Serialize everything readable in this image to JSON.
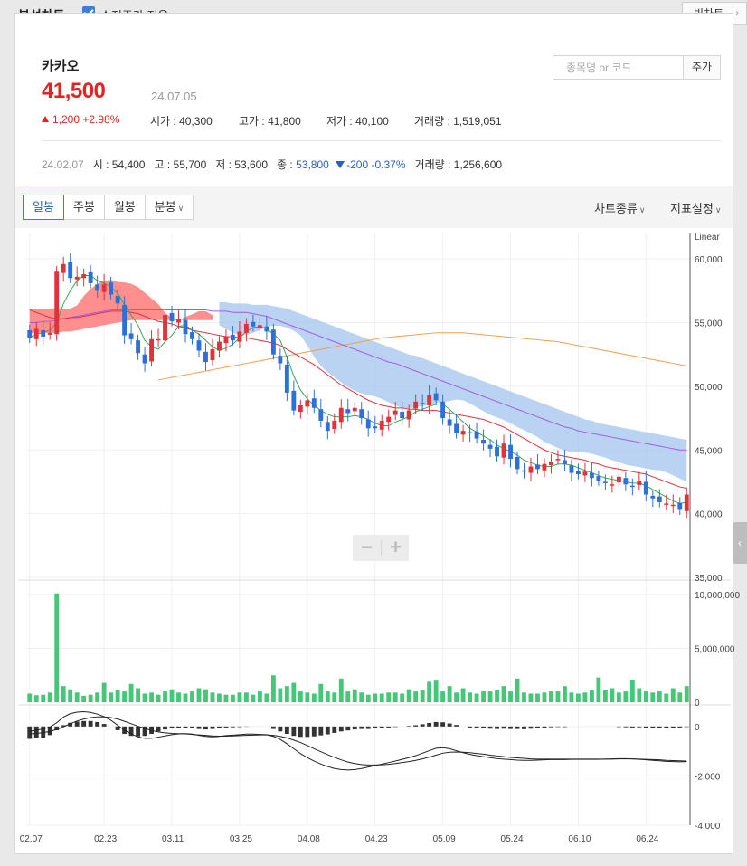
{
  "header": {
    "title": "분석차트",
    "adjusted_label": "수정주가 적용",
    "adjusted_checked": true,
    "big_chart_label": "빅차트"
  },
  "search": {
    "placeholder": "종목명 or 코드",
    "button": "추가"
  },
  "stock": {
    "name": "카카오",
    "price": "41,500",
    "date": "24.07.05",
    "change": "1,200 +2.98%",
    "open": "시가 : 40,300",
    "high": "고가 : 41,800",
    "low": "저가 : 40,100",
    "volume": "거래량 : 1,519,051"
  },
  "compare": {
    "date": "24.02.07",
    "open": "시 : 54,400",
    "high": "고 : 55,700",
    "low": "저 : 53,600",
    "close_label": "종 :",
    "close": "53,800",
    "change": "-200 -0.37%",
    "volume": "거래량 : 1,256,600"
  },
  "tabs": [
    {
      "label": "일봉"
    },
    {
      "label": "주봉"
    },
    {
      "label": "월봉"
    },
    {
      "label": "분봉"
    }
  ],
  "toolbar": {
    "chart_type": "차트종류",
    "indicator": "지표설정"
  },
  "zoom": {
    "minus": "−",
    "plus": "+"
  },
  "colors": {
    "up": "#e0323a",
    "down": "#2e6fd8",
    "volume": "#44c878",
    "cloud_bull": "#ff7b7b",
    "cloud_bear": "#9cc0ee",
    "ma5": "#3aa657",
    "ma20": "#e0323a",
    "ma60": "#a45de0",
    "ma120": "#f0a050"
  },
  "chart_data": {
    "type": "candlestick",
    "scale_label": "Linear",
    "price_axis": {
      "ticks": [
        "60,000",
        "55,000",
        "50,000",
        "45,000",
        "40,000",
        "35,000"
      ],
      "values": [
        60000,
        55000,
        50000,
        45000,
        40000,
        35000
      ],
      "ylim": [
        35000,
        62000
      ]
    },
    "volume_axis": {
      "ticks": [
        "10,000,000",
        "5,000,000",
        "0"
      ],
      "values": [
        10000000,
        5000000,
        0
      ],
      "ylim": [
        0,
        11000000
      ]
    },
    "macd_axis": {
      "ticks": [
        "0",
        "-2,000",
        "-4,000"
      ],
      "values": [
        0,
        -2000,
        -4000
      ],
      "ylim": [
        -4000,
        800
      ]
    },
    "x_ticks": [
      "02.07",
      "02.23",
      "03.11",
      "03.25",
      "04.08",
      "04.23",
      "05.09",
      "05.24",
      "06.10",
      "06.24"
    ],
    "x_tick_index": [
      0,
      11,
      21,
      31,
      41,
      51,
      61,
      71,
      81,
      91
    ],
    "closes": [
      53800,
      54500,
      53900,
      54200,
      59000,
      59600,
      58500,
      58600,
      58800,
      58100,
      57500,
      58000,
      57200,
      56500,
      54000,
      53700,
      52600,
      51800,
      53700,
      53700,
      55600,
      55100,
      55300,
      54100,
      53700,
      52800,
      51900,
      52900,
      53500,
      53900,
      53600,
      54300,
      54900,
      54700,
      54800,
      54300,
      52500,
      51800,
      49500,
      48100,
      48500,
      48900,
      48300,
      47300,
      46500,
      47300,
      48300,
      47900,
      48300,
      47500,
      46700,
      46700,
      47300,
      47600,
      48100,
      47500,
      48100,
      48800,
      48600,
      49300,
      48900,
      47500,
      46900,
      46300,
      46500,
      46300,
      45900,
      45500,
      45100,
      44500,
      45500,
      44300,
      43500,
      43300,
      43700,
      43500,
      43900,
      44100,
      44300,
      43900,
      43200,
      43100,
      43300,
      42800,
      42600,
      42400,
      42300,
      42900,
      42300,
      42100,
      42600,
      41500,
      41200,
      40900,
      40800,
      40700,
      40300,
      41500
    ],
    "ma5": [
      53800,
      54100,
      54200,
      54400,
      55000,
      56500,
      57500,
      58300,
      58700,
      58700,
      58300,
      58100,
      57800,
      57300,
      56400,
      55600,
      54800,
      53600,
      53100,
      52900,
      53500,
      54000,
      54700,
      54800,
      54400,
      54100,
      53600,
      53100,
      52800,
      53000,
      53300,
      53800,
      54300,
      54600,
      54700,
      54500,
      54100,
      53600,
      52300,
      50800,
      49700,
      49000,
      48500,
      48100,
      47800,
      47600,
      47600,
      47600,
      47700,
      47600,
      47400,
      47100,
      46900,
      46900,
      47200,
      47400,
      47600,
      48000,
      48200,
      48400,
      48600,
      48600,
      48200,
      47700,
      47200,
      46700,
      46400,
      46100,
      45800,
      45400,
      45100,
      44900,
      44600,
      44200,
      44000,
      43800,
      43700,
      43700,
      43900,
      43900,
      43800,
      43600,
      43400,
      43200,
      43000,
      42800,
      42700,
      42600,
      42500,
      42400,
      42400,
      42200,
      41900,
      41600,
      41300,
      41000,
      40800,
      40900
    ],
    "ma20": [
      56000,
      55800,
      55600,
      55400,
      55300,
      55300,
      55400,
      55400,
      55500,
      55600,
      55700,
      55800,
      55900,
      55900,
      55900,
      55800,
      55700,
      55500,
      55300,
      55100,
      55000,
      54900,
      54700,
      54600,
      54400,
      54300,
      54200,
      54100,
      54000,
      53900,
      53900,
      53800,
      53800,
      53700,
      53600,
      53500,
      53400,
      53200,
      52900,
      52600,
      52300,
      52000,
      51700,
      51300,
      50900,
      50500,
      50100,
      49800,
      49500,
      49200,
      48900,
      48700,
      48500,
      48400,
      48300,
      48300,
      48200,
      48200,
      48100,
      48100,
      48100,
      48000,
      47900,
      47800,
      47700,
      47600,
      47500,
      47400,
      47200,
      47000,
      46800,
      46500,
      46200,
      45900,
      45600,
      45300,
      45000,
      44800,
      44600,
      44500,
      44400,
      44300,
      44200,
      44000,
      43900,
      43700,
      43600,
      43500,
      43400,
      43300,
      43200,
      43100,
      42900,
      42700,
      42500,
      42300,
      42100,
      42000
    ],
    "ma60": [
      55000,
      55000,
      55100,
      55100,
      55200,
      55300,
      55400,
      55500,
      55600,
      55700,
      55800,
      55900,
      56000,
      56000,
      56000,
      56000,
      56000,
      56000,
      56000,
      56000,
      56000,
      56000,
      56000,
      56000,
      56000,
      56000,
      56000,
      55900,
      55900,
      55900,
      55800,
      55800,
      55800,
      55700,
      55600,
      55500,
      55300,
      55100,
      54900,
      54700,
      54500,
      54300,
      54100,
      53900,
      53700,
      53500,
      53300,
      53100,
      52900,
      52700,
      52500,
      52300,
      52100,
      51900,
      51800,
      51600,
      51400,
      51200,
      51000,
      50800,
      50600,
      50400,
      50200,
      50000,
      49800,
      49600,
      49400,
      49200,
      49000,
      48800,
      48600,
      48400,
      48200,
      48000,
      47800,
      47600,
      47400,
      47200,
      47000,
      46800,
      46700,
      46500,
      46400,
      46300,
      46200,
      46100,
      46000,
      45900,
      45800,
      45700,
      45600,
      45500,
      45400,
      45300,
      45200,
      45100,
      45000,
      45000
    ],
    "ma120_start": 19,
    "ma120": [
      50500,
      50600,
      50700,
      50800,
      50900,
      51000,
      51100,
      51200,
      51300,
      51400,
      51500,
      51600,
      51700,
      51800,
      51900,
      52000,
      52100,
      52200,
      52300,
      52400,
      52500,
      52600,
      52700,
      52800,
      52900,
      53000,
      53100,
      53200,
      53300,
      53400,
      53500,
      53600,
      53700,
      53800,
      53850,
      53900,
      53950,
      54000,
      54050,
      54100,
      54150,
      54200,
      54200,
      54200,
      54200,
      54200,
      54150,
      54100,
      54050,
      54000,
      53950,
      53900,
      53850,
      53800,
      53750,
      53700,
      53650,
      53600,
      53550,
      53500,
      53400,
      53300,
      53200,
      53100,
      53000,
      52900,
      52800,
      52700,
      52600,
      52500,
      52400,
      52300,
      52200,
      52100,
      52000,
      51900,
      51800,
      51700,
      51600
    ],
    "volume": [
      800000,
      650000,
      700000,
      900000,
      10100000,
      1500000,
      1200000,
      900000,
      600000,
      700000,
      900000,
      1800000,
      900000,
      1100000,
      1000000,
      1700000,
      1300000,
      800000,
      900000,
      700000,
      1000000,
      1200000,
      900000,
      800000,
      1000000,
      1300000,
      1200000,
      900000,
      800000,
      700000,
      700000,
      900000,
      900000,
      700000,
      1000000,
      800000,
      2500000,
      1300000,
      1500000,
      1800000,
      1000000,
      900000,
      800000,
      1700000,
      1000000,
      900000,
      2200000,
      1000000,
      1200000,
      900000,
      700000,
      800000,
      800000,
      900000,
      900000,
      800000,
      1200000,
      1000000,
      1100000,
      1900000,
      2000000,
      1000000,
      1500000,
      900000,
      1300000,
      900000,
      800000,
      1000000,
      1000000,
      1100000,
      1500000,
      1000000,
      2200000,
      900000,
      800000,
      800000,
      900000,
      1000000,
      1000000,
      1500000,
      900000,
      800000,
      900000,
      1100000,
      2300000,
      1100000,
      1300000,
      900000,
      1000000,
      2100000,
      1300000,
      1000000,
      900000,
      1000000,
      800000,
      1300000,
      900000,
      1500000
    ],
    "macd_hist": [
      -500,
      -450,
      -450,
      -350,
      -150,
      50,
      150,
      200,
      220,
      220,
      180,
      100,
      0,
      -150,
      -300,
      -380,
      -400,
      -380,
      -300,
      -200,
      -120,
      -80,
      -60,
      -60,
      -80,
      -100,
      -120,
      -100,
      -60,
      -40,
      -30,
      -20,
      -10,
      0,
      0,
      0,
      -100,
      -200,
      -300,
      -380,
      -420,
      -420,
      -400,
      -360,
      -320,
      -260,
      -200,
      -160,
      -120,
      -100,
      -100,
      -80,
      -60,
      -40,
      -20,
      0,
      20,
      50,
      90,
      140,
      180,
      170,
      120,
      60,
      0,
      -40,
      -60,
      -80,
      -90,
      -100,
      -90,
      -100,
      -100,
      -110,
      -90,
      -70,
      -50,
      -30,
      -20,
      -20,
      0,
      0,
      0,
      0,
      0,
      0,
      0,
      -20,
      -30,
      -40,
      -30,
      -50,
      -60,
      -70,
      -60,
      -50,
      -40,
      -20
    ],
    "macd_line": [
      -200,
      -150,
      -100,
      -20,
      150,
      380,
      520,
      580,
      600,
      570,
      500,
      400,
      250,
      50,
      -150,
      -300,
      -420,
      -480,
      -480,
      -430,
      -380,
      -330,
      -300,
      -290,
      -310,
      -360,
      -400,
      -420,
      -400,
      -370,
      -350,
      -330,
      -310,
      -310,
      -320,
      -330,
      -400,
      -520,
      -700,
      -900,
      -1100,
      -1260,
      -1400,
      -1520,
      -1620,
      -1700,
      -1740,
      -1760,
      -1740,
      -1700,
      -1640,
      -1580,
      -1520,
      -1460,
      -1400,
      -1330,
      -1260,
      -1180,
      -1080,
      -980,
      -880,
      -860,
      -900,
      -980,
      -1060,
      -1130,
      -1180,
      -1220,
      -1260,
      -1300,
      -1320,
      -1340,
      -1360,
      -1370,
      -1370,
      -1360,
      -1350,
      -1340,
      -1340,
      -1340,
      -1330,
      -1330,
      -1330,
      -1330,
      -1330,
      -1320,
      -1310,
      -1300,
      -1300,
      -1310,
      -1330,
      -1350,
      -1370,
      -1390,
      -1410,
      -1420,
      -1430,
      -1420
    ],
    "macd_signal": [
      -300,
      -280,
      -250,
      -200,
      -120,
      -10,
      110,
      220,
      300,
      360,
      390,
      390,
      360,
      300,
      210,
      110,
      10,
      -80,
      -160,
      -220,
      -260,
      -280,
      -290,
      -300,
      -320,
      -340,
      -360,
      -380,
      -390,
      -390,
      -380,
      -370,
      -360,
      -350,
      -340,
      -340,
      -360,
      -400,
      -460,
      -550,
      -650,
      -770,
      -900,
      -1020,
      -1140,
      -1250,
      -1350,
      -1440,
      -1500,
      -1540,
      -1560,
      -1560,
      -1550,
      -1530,
      -1500,
      -1460,
      -1420,
      -1370,
      -1310,
      -1240,
      -1160,
      -1080,
      -1040,
      -1030,
      -1040,
      -1060,
      -1090,
      -1120,
      -1160,
      -1190,
      -1220,
      -1250,
      -1270,
      -1290,
      -1310,
      -1320,
      -1320,
      -1320,
      -1320,
      -1320,
      -1320,
      -1320,
      -1320,
      -1320,
      -1320,
      -1320,
      -1320,
      -1310,
      -1310,
      -1310,
      -1320,
      -1330,
      -1340,
      -1350,
      -1370,
      -1380,
      -1390,
      -1400
    ]
  }
}
